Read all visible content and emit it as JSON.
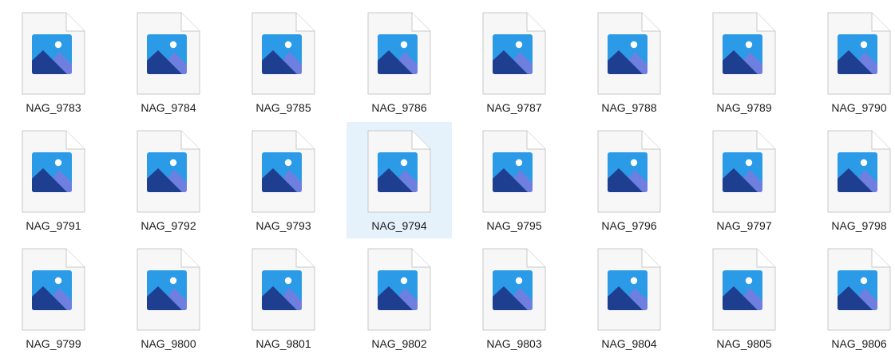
{
  "files": [
    {
      "name": "NAG_9783",
      "icon": "image-file-icon"
    },
    {
      "name": "NAG_9784",
      "icon": "image-file-icon"
    },
    {
      "name": "NAG_9785",
      "icon": "image-file-icon"
    },
    {
      "name": "NAG_9786",
      "icon": "image-file-icon"
    },
    {
      "name": "NAG_9787",
      "icon": "image-file-icon"
    },
    {
      "name": "NAG_9788",
      "icon": "image-file-icon"
    },
    {
      "name": "NAG_9789",
      "icon": "image-file-icon"
    },
    {
      "name": "NAG_9790",
      "icon": "image-file-icon"
    },
    {
      "name": "NAG_9791",
      "icon": "image-file-icon"
    },
    {
      "name": "NAG_9792",
      "icon": "image-file-icon"
    },
    {
      "name": "NAG_9793",
      "icon": "image-file-icon"
    },
    {
      "name": "NAG_9794",
      "icon": "image-file-icon",
      "selected": true
    },
    {
      "name": "NAG_9795",
      "icon": "image-file-icon"
    },
    {
      "name": "NAG_9796",
      "icon": "image-file-icon"
    },
    {
      "name": "NAG_9797",
      "icon": "image-file-icon"
    },
    {
      "name": "NAG_9798",
      "icon": "image-file-icon"
    },
    {
      "name": "NAG_9799",
      "icon": "image-file-icon"
    },
    {
      "name": "NAG_9800",
      "icon": "image-file-icon"
    },
    {
      "name": "NAG_9801",
      "icon": "image-file-icon"
    },
    {
      "name": "NAG_9802",
      "icon": "image-file-icon"
    },
    {
      "name": "NAG_9803",
      "icon": "image-file-icon"
    },
    {
      "name": "NAG_9804",
      "icon": "image-file-icon"
    },
    {
      "name": "NAG_9805",
      "icon": "image-file-icon"
    },
    {
      "name": "NAG_9806",
      "icon": "image-file-icon"
    }
  ],
  "colors": {
    "selection": "#e5f1fb",
    "page": "#f7f7f7",
    "page_border": "#c9c9c9",
    "photo_sky": "#2b9be8",
    "photo_mountain_back": "#6f7fe0",
    "photo_mountain_front": "#1e3f8f",
    "photo_sun": "#ffffff"
  }
}
